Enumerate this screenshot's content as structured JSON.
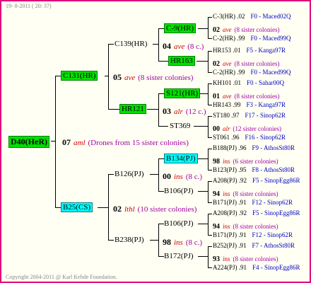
{
  "header": {
    "stamp": "19-  8-2011 ( 20: 37)"
  },
  "footer": {
    "copyright": "Copyright 2004-2011 @ Karl Kehde Foundation."
  },
  "root": {
    "id": "D40(HeR)",
    "year": "07",
    "code": "aml",
    "note": "(Drones from 15 sister colonies)"
  },
  "p": {
    "id": "C131(HR)",
    "year": "05",
    "code": "ave",
    "note": "(8 sister colonies)"
  },
  "m": {
    "id": "B25(CS)",
    "year": "02",
    "code": "lthl",
    "note": "(10 sister colonies)"
  },
  "pp": {
    "id": "C139(HR)",
    "year": "04",
    "code": "ave",
    "note": "(8 c.)"
  },
  "pm": {
    "id": "HR121",
    "year": "03",
    "code": "alr",
    "note": "(12 c.)"
  },
  "mp": {
    "id": "B126(PJ)",
    "year": "00",
    "code": "ins",
    "note": "(8 c.)"
  },
  "mm": {
    "id": "B238(PJ)",
    "year": "98",
    "code": "ins",
    "note": "(8 c.)"
  },
  "ppp": "C-9(HR)",
  "ppm": "HR163",
  "pmp": "S121(HR)",
  "pmm": "ST369",
  "mpp": "B134(PJ)",
  "mpm": "B106(PJ)",
  "mmp": "B106(PJ)",
  "mmm": "B172(PJ)",
  "leaves": [
    {
      "a": "C-3(HR) .02",
      "b": "F0 - Maced02Q",
      "y": "02",
      "c": "ave",
      "n": "(8 sister colonies)"
    },
    {
      "a": "C-2(HR) .99",
      "b": "F0 - Maced99Q"
    },
    {
      "a": "HR153 .01",
      "b": "F5 - Kanga97R",
      "y": "02",
      "c": "ave",
      "n": "(8 sister colonies)"
    },
    {
      "a": "C-2(HR) .99",
      "b": "F0 - Maced99Q"
    },
    {
      "a": "KH101 .01",
      "b": "F0 - Sahar00Q",
      "y": "01",
      "c": "ave",
      "n": "(8 sister colonies)"
    },
    {
      "a": "HR143 .99",
      "b": "F3 - Kanga97R"
    },
    {
      "a": "ST180 .97",
      "b": "F17 - Sinop62R",
      "y": "00",
      "c": "alr",
      "n": "(12 sister colonies)"
    },
    {
      "a": "ST061 .96",
      "b": "F16 - Sinop62R"
    },
    {
      "a": "B188(PJ) .96",
      "b": "F9 - AthosSt80R",
      "y": "98",
      "c": "ins",
      "n": "(6 sister colonies)"
    },
    {
      "a": "B123(PJ) .95",
      "b": "F8 - AthosSt80R"
    },
    {
      "a": "A208(PJ) .92",
      "b": "F5 - SinopEgg86R",
      "y": "94",
      "c": "ins",
      "n": "(8 sister colonies)"
    },
    {
      "a": "B171(PJ) .91",
      "b": "F12 - Sinop62R"
    },
    {
      "a": "A208(PJ) .92",
      "b": "F5 - SinopEgg86R",
      "y": "94",
      "c": "ins",
      "n": "(8 sister colonies)"
    },
    {
      "a": "B171(PJ) .91",
      "b": "F12 - Sinop62R"
    },
    {
      "a": "B252(PJ) .91",
      "b": "F7 - AthosSt80R",
      "y": "93",
      "c": "ins",
      "n": "(8 sister colonies)"
    },
    {
      "a": "A224(PJ) .91",
      "b": "F4 - SinopEgg86R"
    }
  ]
}
